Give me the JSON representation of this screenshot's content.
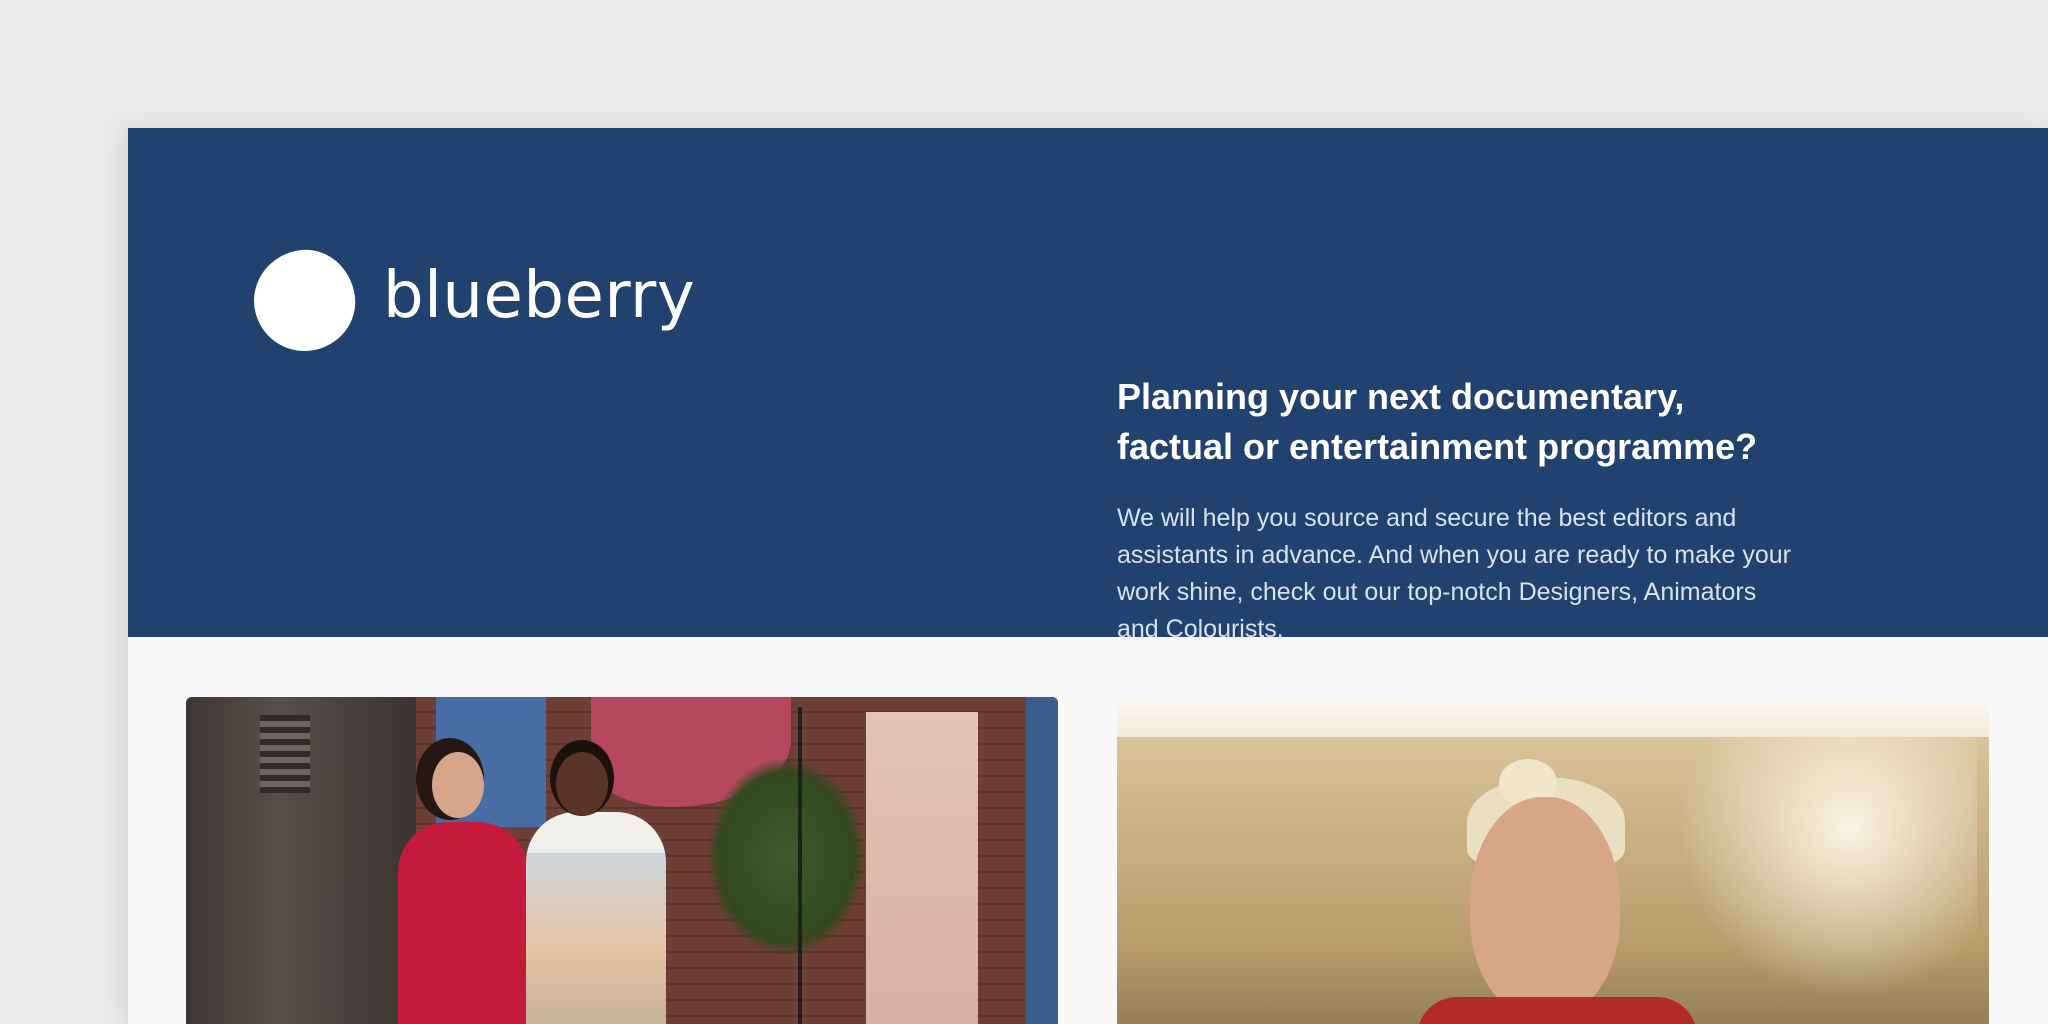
{
  "brand": {
    "logo_text": "blueberry"
  },
  "hero": {
    "title_line1": "Planning your next documentary,",
    "title_line2": "factual or entertainment programme?",
    "body": "We will help you source and secure the best editors and assistants in advance. And when you are ready to make your work shine, check out our top-notch Designers, Animators and Colourists."
  },
  "colors": {
    "hero_background": "#21426f",
    "page_background": "#f8f8f8",
    "outer_background": "#eaeaea",
    "text_light": "#ffffff"
  },
  "images": [
    {
      "name": "two-women-textile-studio-photo"
    },
    {
      "name": "smiling-woman-sunlit-outdoors-photo"
    }
  ]
}
